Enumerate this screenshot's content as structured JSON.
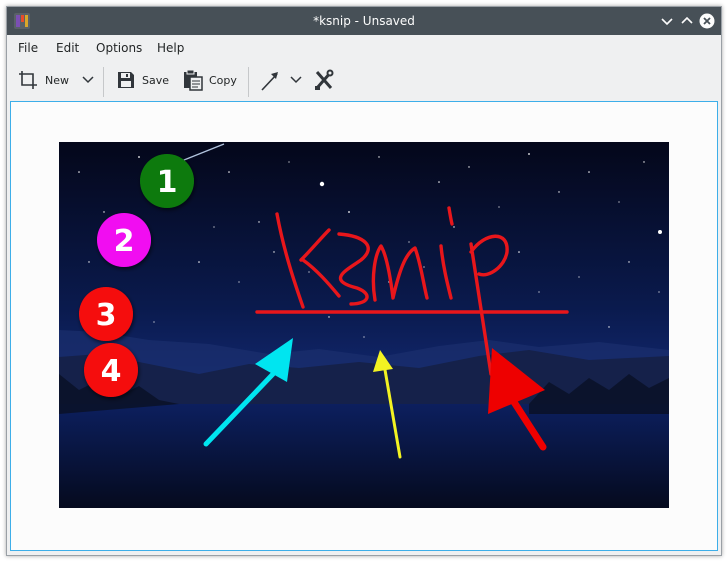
{
  "window": {
    "title": "*ksnip - Unsaved",
    "icon": "ksnip-app-icon"
  },
  "menu": {
    "items": [
      {
        "label": "File"
      },
      {
        "label": "Edit"
      },
      {
        "label": "Options"
      },
      {
        "label": "Help"
      }
    ]
  },
  "toolbar": {
    "new_label": "New",
    "save_label": "Save",
    "copy_label": "Copy"
  },
  "annotations": {
    "markers": [
      {
        "number": "1",
        "color": "#0b7a0b"
      },
      {
        "number": "2",
        "color": "#f10df1"
      },
      {
        "number": "3",
        "color": "#f50a0a"
      },
      {
        "number": "4",
        "color": "#f50a0a"
      }
    ],
    "handwriting": "ksnip",
    "colors": {
      "underline": "#e8161b",
      "arrow_cyan": "#00e5f0",
      "arrow_yellow": "#f3f322",
      "arrow_red": "#ee0000"
    }
  },
  "colors": {
    "titlebar": "#475057",
    "selection_border": "#3daee9"
  }
}
